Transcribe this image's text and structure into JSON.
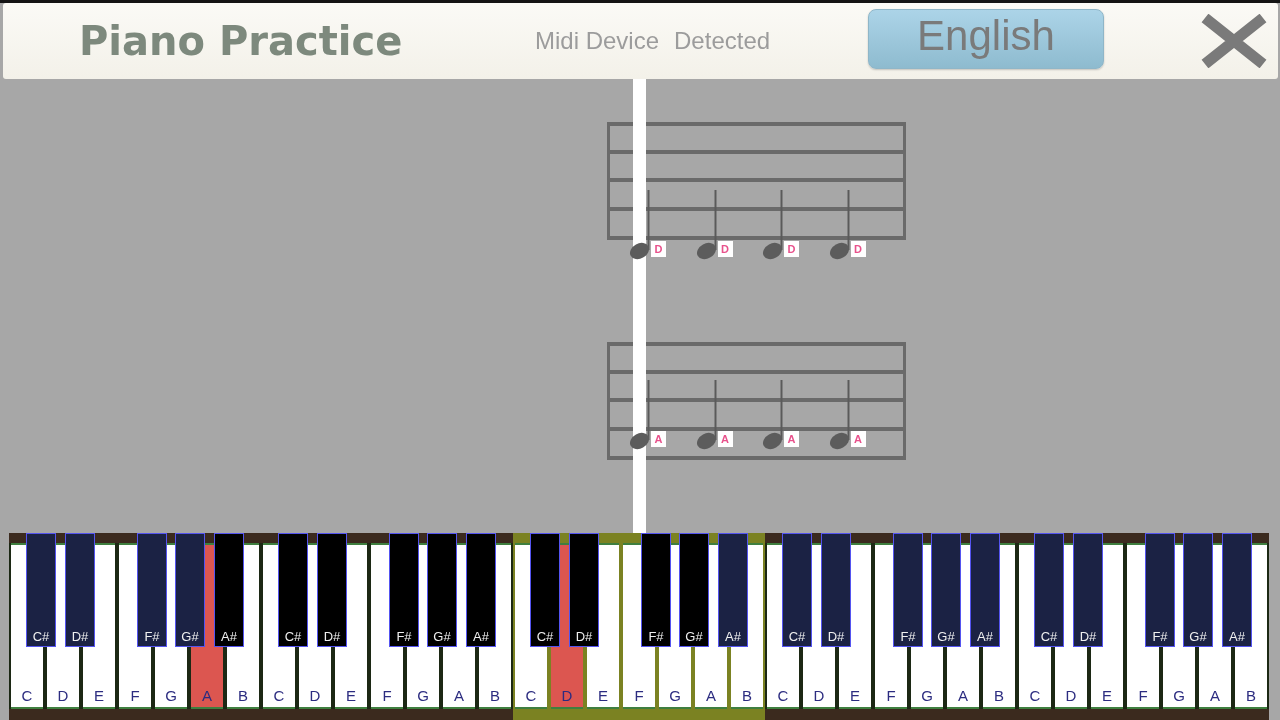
{
  "header": {
    "title": "Piano Practice",
    "midi_status": [
      "Midi Device",
      "Detected"
    ],
    "language_button": "English"
  },
  "staves": [
    {
      "notes": [
        {
          "label": "D"
        },
        {
          "label": "D"
        },
        {
          "label": "D"
        },
        {
          "label": "D"
        }
      ]
    },
    {
      "notes": [
        {
          "label": "A"
        },
        {
          "label": "A"
        },
        {
          "label": "A"
        },
        {
          "label": "A"
        }
      ]
    }
  ],
  "keyboard": {
    "octaves": [
      {
        "highlighted": false,
        "white_keys": [
          {
            "label": "C",
            "highlighted": false
          },
          {
            "label": "D",
            "highlighted": false
          },
          {
            "label": "E",
            "highlighted": false
          },
          {
            "label": "F",
            "highlighted": false
          },
          {
            "label": "G",
            "highlighted": false
          },
          {
            "label": "A",
            "highlighted": true
          },
          {
            "label": "B",
            "highlighted": false
          }
        ],
        "black_keys": [
          {
            "label": "C#",
            "color": "#1b2244"
          },
          {
            "label": "D#",
            "color": "#1b2244"
          },
          {
            "label": "F#",
            "color": "#1b2244"
          },
          {
            "label": "G#",
            "color": "#1b2244"
          },
          {
            "label": "A#",
            "color": "#000000"
          }
        ]
      },
      {
        "highlighted": false,
        "white_keys": [
          {
            "label": "C",
            "highlighted": false
          },
          {
            "label": "D",
            "highlighted": false
          },
          {
            "label": "E",
            "highlighted": false
          },
          {
            "label": "F",
            "highlighted": false
          },
          {
            "label": "G",
            "highlighted": false
          },
          {
            "label": "A",
            "highlighted": false
          },
          {
            "label": "B",
            "highlighted": false
          }
        ],
        "black_keys": [
          {
            "label": "C#",
            "color": "#000000"
          },
          {
            "label": "D#",
            "color": "#000000"
          },
          {
            "label": "F#",
            "color": "#000000"
          },
          {
            "label": "G#",
            "color": "#000000"
          },
          {
            "label": "A#",
            "color": "#000000"
          }
        ]
      },
      {
        "highlighted": true,
        "white_keys": [
          {
            "label": "C",
            "highlighted": false
          },
          {
            "label": "D",
            "highlighted": true
          },
          {
            "label": "E",
            "highlighted": false
          },
          {
            "label": "F",
            "highlighted": false
          },
          {
            "label": "G",
            "highlighted": false
          },
          {
            "label": "A",
            "highlighted": false
          },
          {
            "label": "B",
            "highlighted": false
          }
        ],
        "black_keys": [
          {
            "label": "C#",
            "color": "#000000"
          },
          {
            "label": "D#",
            "color": "#000000"
          },
          {
            "label": "F#",
            "color": "#000000"
          },
          {
            "label": "G#",
            "color": "#000000"
          },
          {
            "label": "A#",
            "color": "#1b2244"
          }
        ]
      },
      {
        "highlighted": false,
        "white_keys": [
          {
            "label": "C",
            "highlighted": false
          },
          {
            "label": "D",
            "highlighted": false
          },
          {
            "label": "E",
            "highlighted": false
          },
          {
            "label": "F",
            "highlighted": false
          },
          {
            "label": "G",
            "highlighted": false
          },
          {
            "label": "A",
            "highlighted": false
          },
          {
            "label": "B",
            "highlighted": false
          }
        ],
        "black_keys": [
          {
            "label": "C#",
            "color": "#1b2244"
          },
          {
            "label": "D#",
            "color": "#1b2244"
          },
          {
            "label": "F#",
            "color": "#1b2244"
          },
          {
            "label": "G#",
            "color": "#1b2244"
          },
          {
            "label": "A#",
            "color": "#1b2244"
          }
        ]
      },
      {
        "highlighted": false,
        "white_keys": [
          {
            "label": "C",
            "highlighted": false
          },
          {
            "label": "D",
            "highlighted": false
          },
          {
            "label": "E",
            "highlighted": false
          },
          {
            "label": "F",
            "highlighted": false
          },
          {
            "label": "G",
            "highlighted": false
          },
          {
            "label": "A",
            "highlighted": false
          },
          {
            "label": "B",
            "highlighted": false
          }
        ],
        "black_keys": [
          {
            "label": "C#",
            "color": "#1b2244"
          },
          {
            "label": "D#",
            "color": "#1b2244"
          },
          {
            "label": "F#",
            "color": "#1b2244"
          },
          {
            "label": "G#",
            "color": "#1b2244"
          },
          {
            "label": "A#",
            "color": "#1b2244"
          }
        ]
      }
    ]
  }
}
